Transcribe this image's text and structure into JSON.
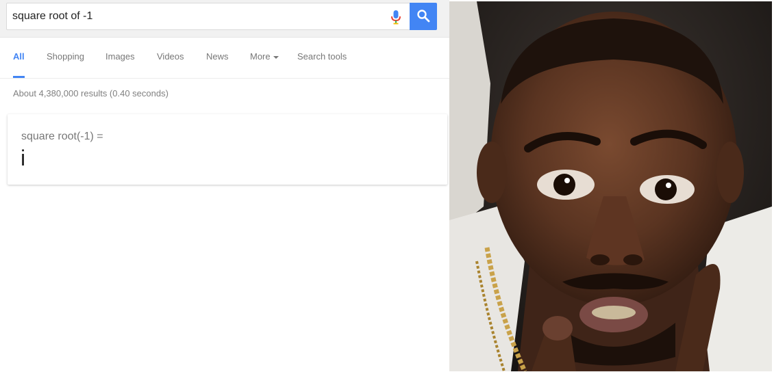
{
  "search": {
    "query": "square root of -1"
  },
  "tabs": [
    {
      "label": "All"
    },
    {
      "label": "Shopping"
    },
    {
      "label": "Images"
    },
    {
      "label": "Videos"
    },
    {
      "label": "News"
    },
    {
      "label": "More"
    },
    {
      "label": "Search tools"
    }
  ],
  "results": {
    "stats": "About 4,380,000 results (0.40 seconds)"
  },
  "calculator": {
    "expression": "square root(-1) =",
    "result": "i"
  },
  "colors": {
    "accent": "#4285f4",
    "tab_text": "#777777"
  },
  "icons": {
    "mic": "microphone-icon",
    "search": "magnifier-icon"
  },
  "photo": {
    "subject": "reaction-face-photo"
  }
}
